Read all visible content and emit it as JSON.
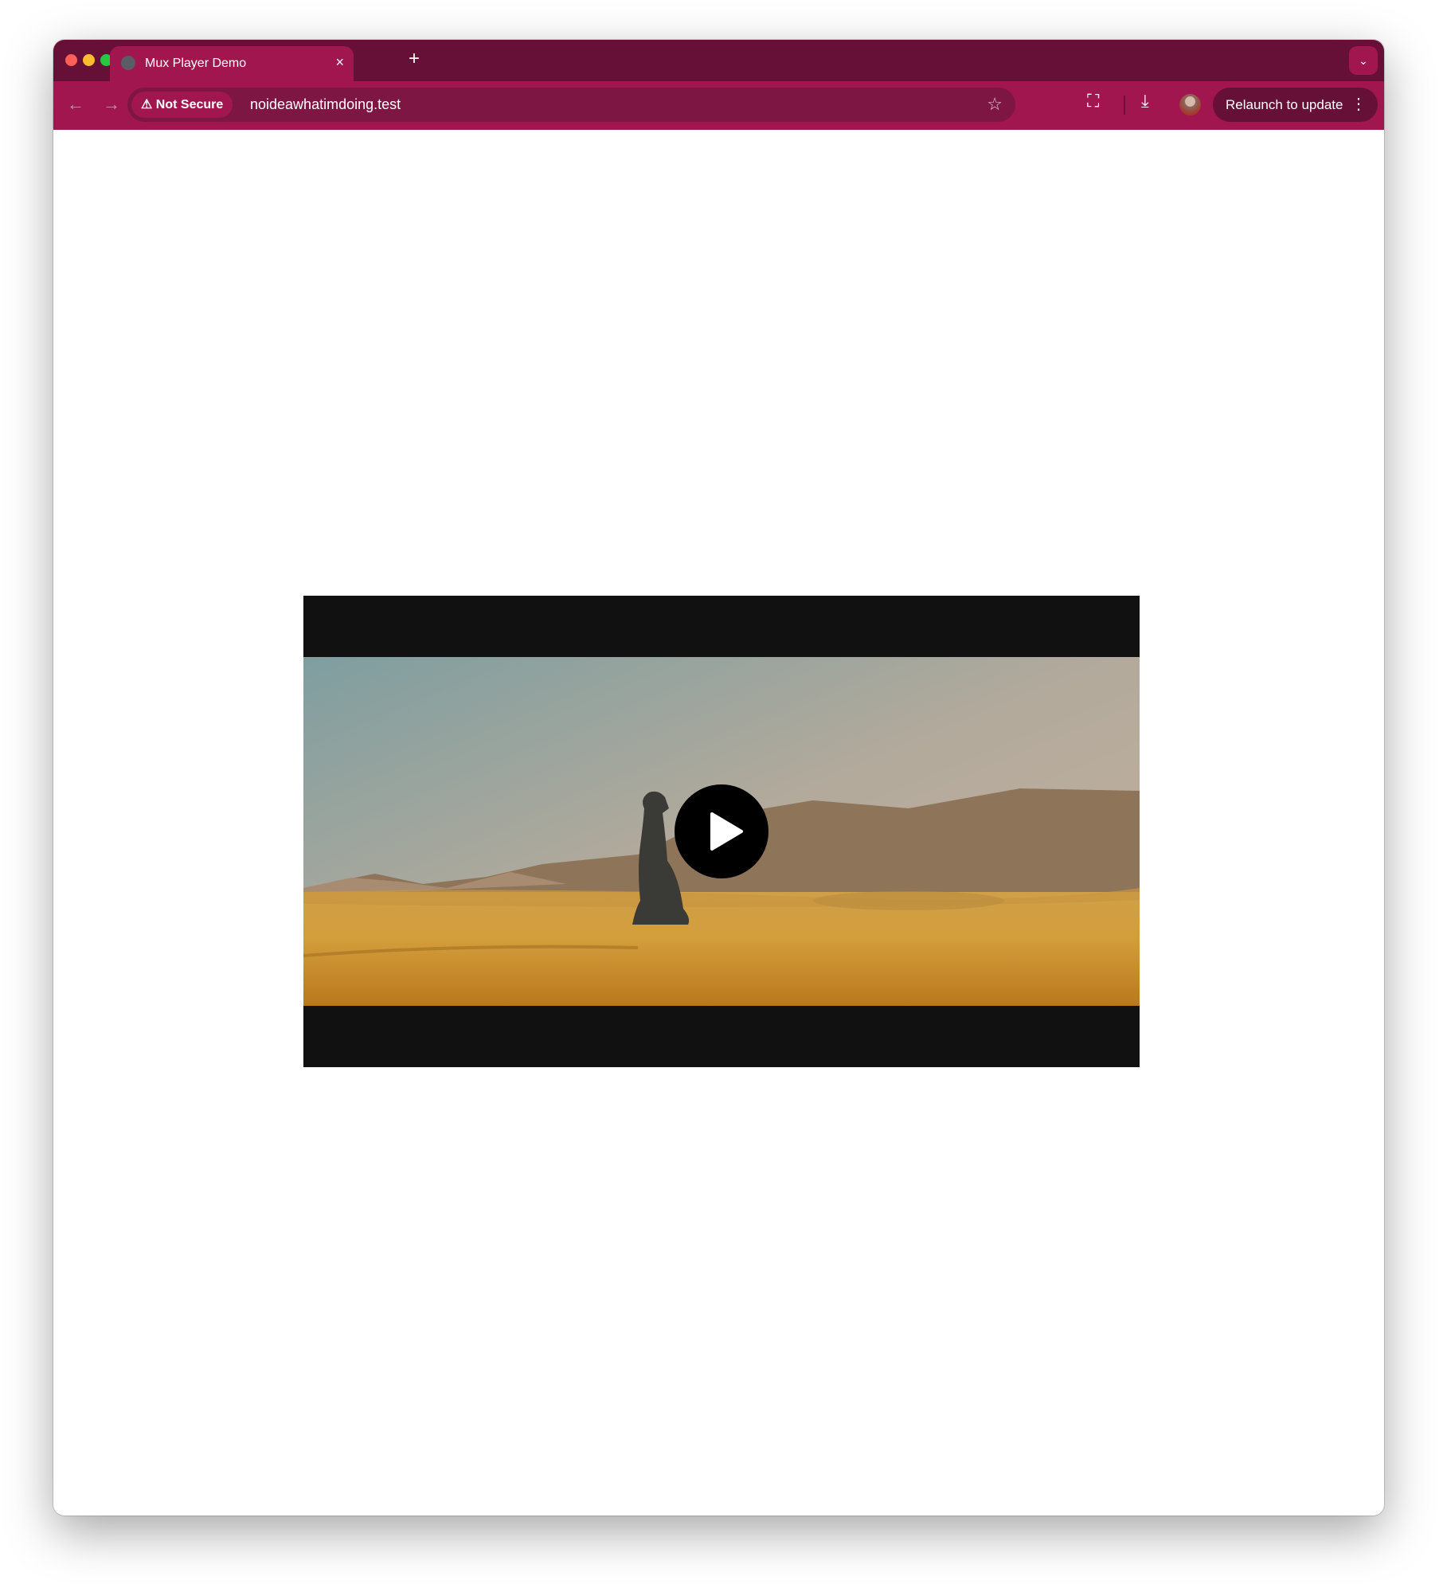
{
  "browser": {
    "tab": {
      "title": "Mux Player Demo",
      "close_label": "×"
    },
    "new_tab_label": "+",
    "tab_menu_icon": "chevron-down-icon",
    "security_chip": "Not Secure",
    "url": "noideawhatimdoing.test",
    "relaunch_label": "Relaunch to update",
    "theme_colors": {
      "tabbar": "#660f37",
      "toolbar": "#a1164f",
      "omnibox": "#7d1643"
    }
  },
  "player": {
    "state": "paused",
    "play_icon": "play-icon"
  }
}
